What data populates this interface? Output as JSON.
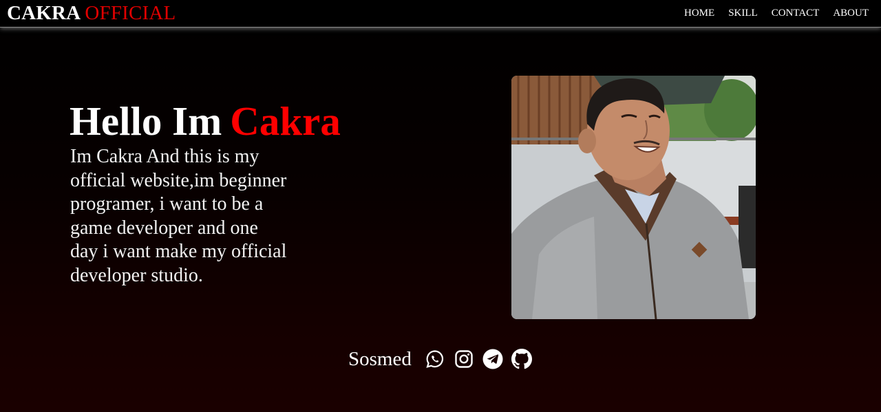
{
  "navbar": {
    "brand_first": "CAKRA",
    "brand_second": "OFFICIAL",
    "links": [
      "HOME",
      "SKILL",
      "CONTACT",
      "ABOUT"
    ]
  },
  "hero": {
    "title_first": "Hello Im",
    "title_second": "Cakra",
    "description": "Im Cakra And this is my official website,im beginner programer, i want to be a game developer and one day i want make my official developer studio."
  },
  "social": {
    "label": "Sosmed",
    "icons": [
      "whatsapp-icon",
      "instagram-icon",
      "telegram-icon",
      "github-icon"
    ]
  },
  "colors": {
    "accent": "#ff0000",
    "background": "#000000",
    "text": "#ffffff"
  }
}
